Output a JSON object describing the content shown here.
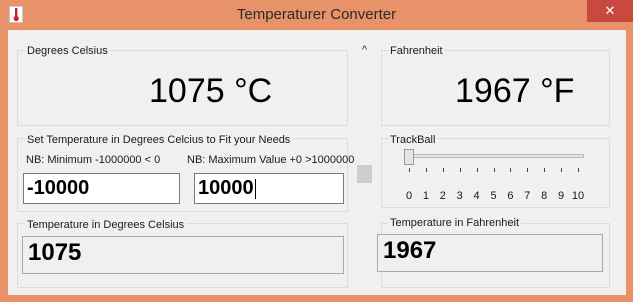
{
  "window": {
    "title": "Temperaturer Converter",
    "close_icon": "✕"
  },
  "celsius": {
    "group_label": "Degrees Celsius",
    "display": "1075 °C",
    "range_group_label": "Set  Temperature in Degrees Celcius to Fit your Needs",
    "min_note": "NB: Minimum -1000000 < 0",
    "max_note": "NB: Maximum Value +0 >1000000",
    "min_input": "-10000",
    "max_input": "10000",
    "readout_label": "Temperature in Degrees Celsius",
    "readout_value": "1075"
  },
  "scroll": {
    "up_icon": "^"
  },
  "fahrenheit": {
    "group_label": "Fahrenheit",
    "display": "1967 °F",
    "trackbar_label": "TrackBall",
    "trackbar_ticks": [
      "0",
      "1",
      "2",
      "3",
      "4",
      "5",
      "6",
      "7",
      "8",
      "9",
      "10"
    ],
    "trackbar_value": 0,
    "readout_label": "Temperature in Fahrenheit",
    "readout_value": "1967"
  }
}
